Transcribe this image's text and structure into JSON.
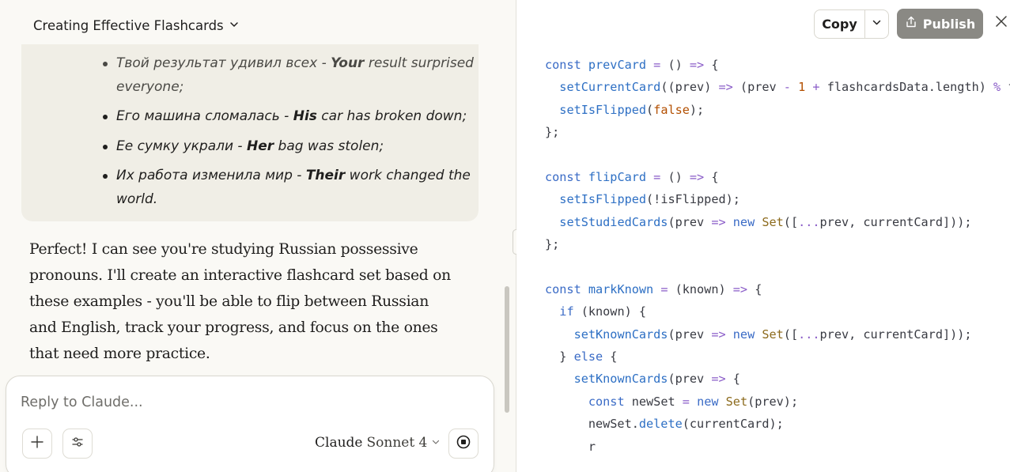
{
  "conversation": {
    "title": "Creating Effective Flashcards"
  },
  "user_message": {
    "items": [
      {
        "ru": "Твой результат удивил всех - ",
        "bold": "Your",
        "en": " result surprised everyone;"
      },
      {
        "ru": "Его машина сломалась - ",
        "bold": "His",
        "en": " car has broken down;"
      },
      {
        "ru": "Ее сумку украли - ",
        "bold": "Her",
        "en": " bag was stolen;"
      },
      {
        "ru": "Их работа изменила мир - ",
        "bold": "Their",
        "en": " work changed the world."
      }
    ]
  },
  "assistant_message": {
    "text": "Perfect! I can see you're studying Russian possessive pronouns. I'll create an interactive flashcard set based on these examples - you'll be able to flip between Russian and English, track your progress, and focus on the ones that need more practice."
  },
  "composer": {
    "placeholder": "Reply to Claude...",
    "model_brand": "Claude",
    "model_name": "Sonnet 4"
  },
  "artifact_toolbar": {
    "copy_label": "Copy",
    "publish_label": "Publish"
  },
  "code_lines": [
    [
      [
        "k",
        "const "
      ],
      [
        "f",
        "prevCard"
      ],
      [
        "o",
        " = "
      ],
      [
        "p",
        "() "
      ],
      [
        "o",
        "=>"
      ],
      [
        "p",
        " {"
      ]
    ],
    [
      [
        "p",
        "  "
      ],
      [
        "f",
        "setCurrentCard"
      ],
      [
        "p",
        "(("
      ],
      [
        "p",
        "prev"
      ],
      [
        "p",
        ") "
      ],
      [
        "o",
        "=>"
      ],
      [
        "p",
        " (prev "
      ],
      [
        "o",
        "-"
      ],
      [
        "p",
        " "
      ],
      [
        "n",
        "1"
      ],
      [
        "p",
        " "
      ],
      [
        "o",
        "+"
      ],
      [
        "p",
        " flashcardsData.length) "
      ],
      [
        "o",
        "%"
      ],
      [
        "p",
        " flashcardsData.length));"
      ]
    ],
    [
      [
        "p",
        "  "
      ],
      [
        "f",
        "setIsFlipped"
      ],
      [
        "p",
        "("
      ],
      [
        "n",
        "false"
      ],
      [
        "p",
        ");"
      ]
    ],
    [
      [
        "p",
        "};"
      ]
    ],
    [
      [
        "p",
        ""
      ]
    ],
    [
      [
        "k",
        "const "
      ],
      [
        "f",
        "flipCard"
      ],
      [
        "o",
        " = "
      ],
      [
        "p",
        "() "
      ],
      [
        "o",
        "=>"
      ],
      [
        "p",
        " {"
      ]
    ],
    [
      [
        "p",
        "  "
      ],
      [
        "f",
        "setIsFlipped"
      ],
      [
        "p",
        "(!isFlipped);"
      ]
    ],
    [
      [
        "p",
        "  "
      ],
      [
        "f",
        "setStudiedCards"
      ],
      [
        "p",
        "(prev "
      ],
      [
        "o",
        "=>"
      ],
      [
        "p",
        " "
      ],
      [
        "k",
        "new "
      ],
      [
        "c",
        "Set"
      ],
      [
        "p",
        "(["
      ],
      [
        "o",
        "..."
      ],
      [
        "p",
        "prev, currentCard]));"
      ]
    ],
    [
      [
        "p",
        "};"
      ]
    ],
    [
      [
        "p",
        ""
      ]
    ],
    [
      [
        "k",
        "const "
      ],
      [
        "f",
        "markKnown"
      ],
      [
        "o",
        " = "
      ],
      [
        "p",
        "(known) "
      ],
      [
        "o",
        "=>"
      ],
      [
        "p",
        " {"
      ]
    ],
    [
      [
        "p",
        "  "
      ],
      [
        "k",
        "if"
      ],
      [
        "p",
        " (known) {"
      ]
    ],
    [
      [
        "p",
        "    "
      ],
      [
        "f",
        "setKnownCards"
      ],
      [
        "p",
        "(prev "
      ],
      [
        "o",
        "=>"
      ],
      [
        "p",
        " "
      ],
      [
        "k",
        "new "
      ],
      [
        "c",
        "Set"
      ],
      [
        "p",
        "(["
      ],
      [
        "o",
        "..."
      ],
      [
        "p",
        "prev, currentCard]));"
      ]
    ],
    [
      [
        "p",
        "  } "
      ],
      [
        "k",
        "else"
      ],
      [
        "p",
        " {"
      ]
    ],
    [
      [
        "p",
        "    "
      ],
      [
        "f",
        "setKnownCards"
      ],
      [
        "p",
        "(prev "
      ],
      [
        "o",
        "=>"
      ],
      [
        "p",
        " {"
      ]
    ],
    [
      [
        "p",
        "      "
      ],
      [
        "k",
        "const "
      ],
      [
        "p",
        "newSet "
      ],
      [
        "o",
        "="
      ],
      [
        "p",
        " "
      ],
      [
        "k",
        "new "
      ],
      [
        "c",
        "Set"
      ],
      [
        "p",
        "(prev);"
      ]
    ],
    [
      [
        "p",
        "      newSet."
      ],
      [
        "f",
        "delete"
      ],
      [
        "p",
        "(currentCard);"
      ]
    ],
    [
      [
        "p",
        "      r"
      ]
    ]
  ],
  "colors": {
    "page_bg": "#faf9f5",
    "bubble_bg": "#f0eee6",
    "publish_bg": "#8a8984",
    "code_keyword": "#3a6bc6",
    "code_function": "#2d6fc4",
    "code_operator": "#8a5cc8",
    "code_number": "#b34f00",
    "code_class": "#8c6a1c"
  }
}
